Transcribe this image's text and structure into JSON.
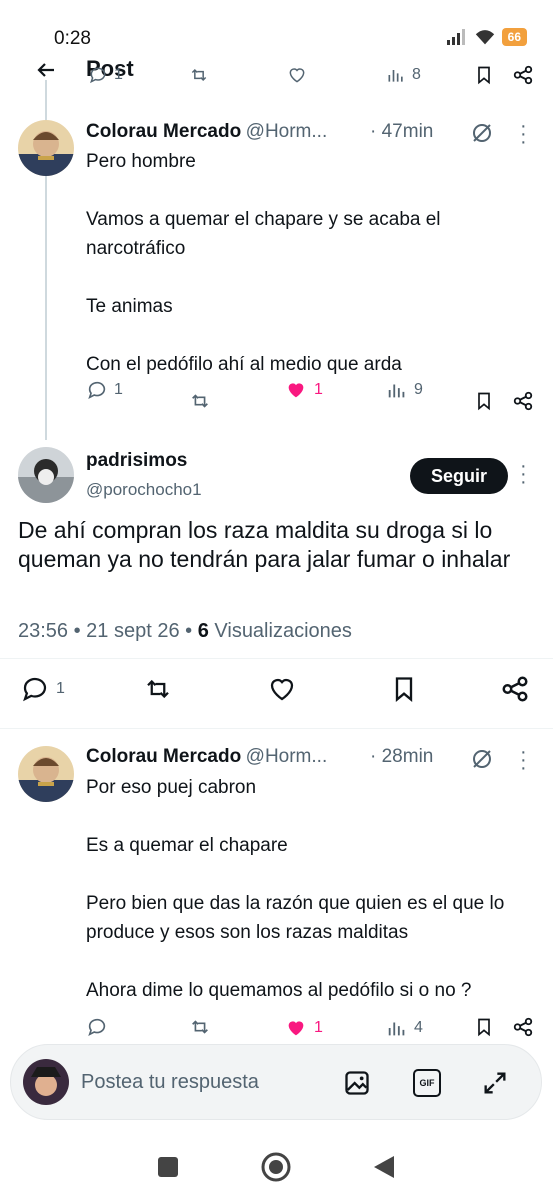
{
  "status": {
    "time": "0:28",
    "battery": "66"
  },
  "header": {
    "title": "Post",
    "top_views": "8",
    "top_replies": "1"
  },
  "tweet1": {
    "name": "Colorau Mercado",
    "handle": "@Horm...",
    "time": "· 47min",
    "text": "Pero hombre\n\nVamos a quemar el chapare y se acaba el narcotráfico\n\nTe animas\n\nCon el pedófilo ahí al medio que arda",
    "replies": "1",
    "likes": "1",
    "views": "9"
  },
  "main": {
    "name": "padrisimos",
    "handle": "@porochocho1",
    "follow": "Seguir",
    "text": "De ahí compran los raza maldita su droga si lo queman ya no tendrán para jalar fumar o inhalar",
    "meta_time": "23:56 • 21 sept 26 •",
    "meta_views_count": "6",
    "meta_views_label": "Visualizaciones",
    "replies": "1"
  },
  "tweet2": {
    "name": "Colorau Mercado",
    "handle": "@Horm...",
    "time": "· 28min",
    "text": "Por eso puej cabron\n\nEs a quemar el chapare\n\nPero bien que das la razón que quien es el que lo produce y esos son los razas malditas\n\nAhora dime lo quemamos al pedófilo si o no ?",
    "likes": "1",
    "views": "4"
  },
  "reply_bar": {
    "placeholder": "Postea tu respuesta"
  },
  "colors": {
    "like_pink": "#f91880",
    "follow_bg": "#0f1419",
    "muted": "#536471",
    "battery": "#f2a03d"
  }
}
